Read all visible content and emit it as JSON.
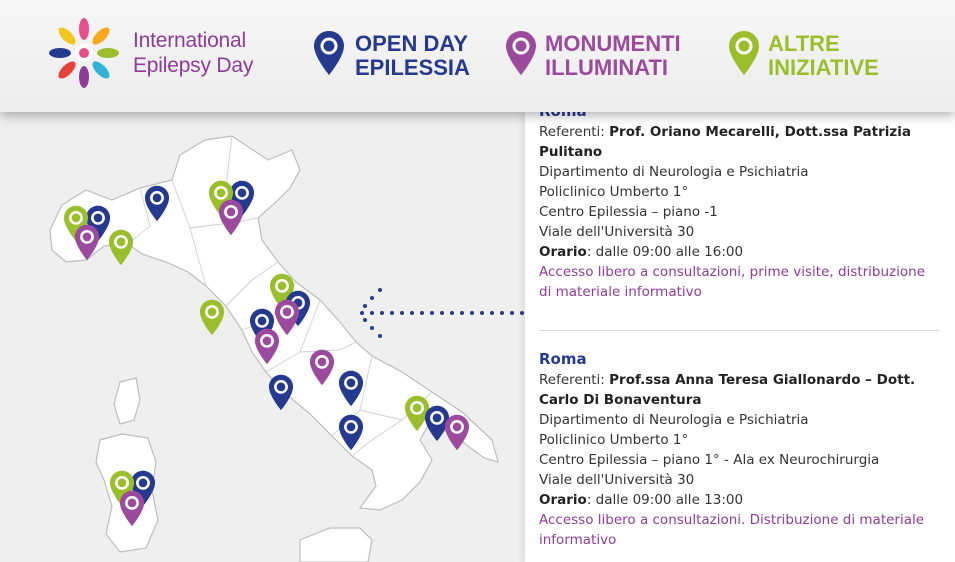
{
  "header": {
    "logo_line1": "International",
    "logo_line2": "Epilepsy Day",
    "legend": [
      {
        "line1": "OPEN DAY",
        "line2": "EPILESSIA",
        "color": "#253a8e",
        "icon": "map-pin-blue-icon"
      },
      {
        "line1": "MONUMENTI",
        "line2": "ILLUMINATI",
        "color": "#9c4a9e",
        "icon": "map-pin-purple-icon"
      },
      {
        "line1": "ALTRE",
        "line2": "INIZIATIVE",
        "color": "#9bbe2d",
        "icon": "map-pin-green-icon"
      }
    ]
  },
  "colors": {
    "blue": "#253a8e",
    "purple": "#9c4a9e",
    "green": "#9bbe2d",
    "map_fill": "#ffffff",
    "map_stroke": "#bdbdbd"
  },
  "entries": [
    {
      "city": "Roma",
      "referenti_label": "Referenti: ",
      "referenti": "Prof. Oriano Mecarelli, Dott.ssa Patrizia Pulitano",
      "lines": [
        "Dipartimento di Neurologia e Psichiatria",
        "Policlinico Umberto 1°",
        "Centro Epilessia – piano -1",
        "Viale dell'Università 30"
      ],
      "orario_label": "Orario",
      "orario": ": dalle 09:00 alle 16:00",
      "note": "Accesso libero a consultazioni, prime visite, distribuzione di materiale informativo"
    },
    {
      "city": "Roma",
      "referenti_label": "Referenti: ",
      "referenti": "Prof.ssa Anna Teresa Giallonardo – Dott. Carlo Di Bonaventura",
      "lines": [
        "Dipartimento di Neurologia e Psichiatria",
        "Policlinico Umberto 1°",
        "Centro Epilessia – piano 1° - Ala ex Neurochirurgia",
        "Viale dell'Università 30"
      ],
      "orario_label": "Orario",
      "orario": ": dalle 09:00 alle 13:00",
      "note": "Accesso libero a consultazioni. Distribuzione di materiale informativo"
    }
  ]
}
